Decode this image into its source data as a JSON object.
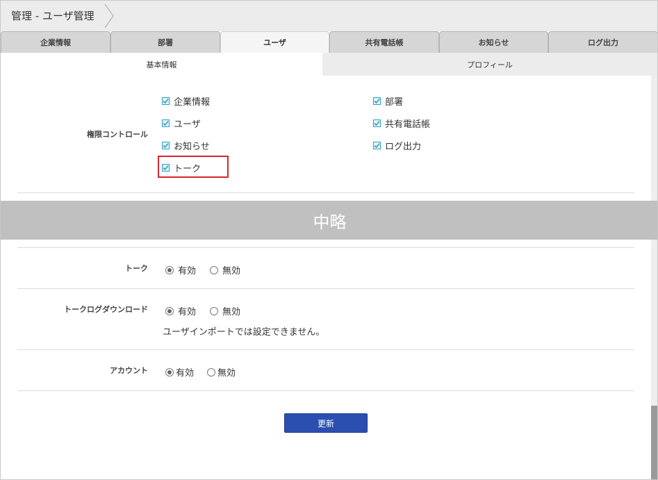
{
  "breadcrumb": {
    "title": "管理 - ユーザ管理"
  },
  "tabs": [
    {
      "label": "企業情報",
      "active": false
    },
    {
      "label": "部署",
      "active": false
    },
    {
      "label": "ユーザ",
      "active": true
    },
    {
      "label": "共有電話帳",
      "active": false
    },
    {
      "label": "お知らせ",
      "active": false
    },
    {
      "label": "ログ出力",
      "active": false
    }
  ],
  "subtabs": [
    {
      "label": "基本情報",
      "active": true
    },
    {
      "label": "プロフィール",
      "active": false
    }
  ],
  "permissions": {
    "label": "権限コントロール",
    "items": [
      {
        "label": "企業情報",
        "checked": true
      },
      {
        "label": "部署",
        "checked": true
      },
      {
        "label": "ユーザ",
        "checked": true
      },
      {
        "label": "共有電話帳",
        "checked": true
      },
      {
        "label": "お知らせ",
        "checked": true
      },
      {
        "label": "ログ出力",
        "checked": true
      },
      {
        "label": "トーク",
        "checked": true,
        "highlighted": true
      }
    ]
  },
  "omission": {
    "label": "中略"
  },
  "settings": [
    {
      "label": "トーク",
      "options": [
        "有効",
        "無効"
      ],
      "selected": "有効"
    },
    {
      "label": "トークログダウンロード",
      "options": [
        "有効",
        "無効"
      ],
      "selected": "有効",
      "note": "ユーザインポートでは設定できません。"
    },
    {
      "label": "アカウント",
      "options": [
        "有効",
        "無効"
      ],
      "selected": "有効"
    }
  ],
  "actions": {
    "update_label": "更新"
  },
  "colors": {
    "checkbox_accent": "#2a9fc4",
    "highlight_border": "#d6262d",
    "update_button": "#2a4fb0",
    "omission_band": "#c0c0c0"
  }
}
